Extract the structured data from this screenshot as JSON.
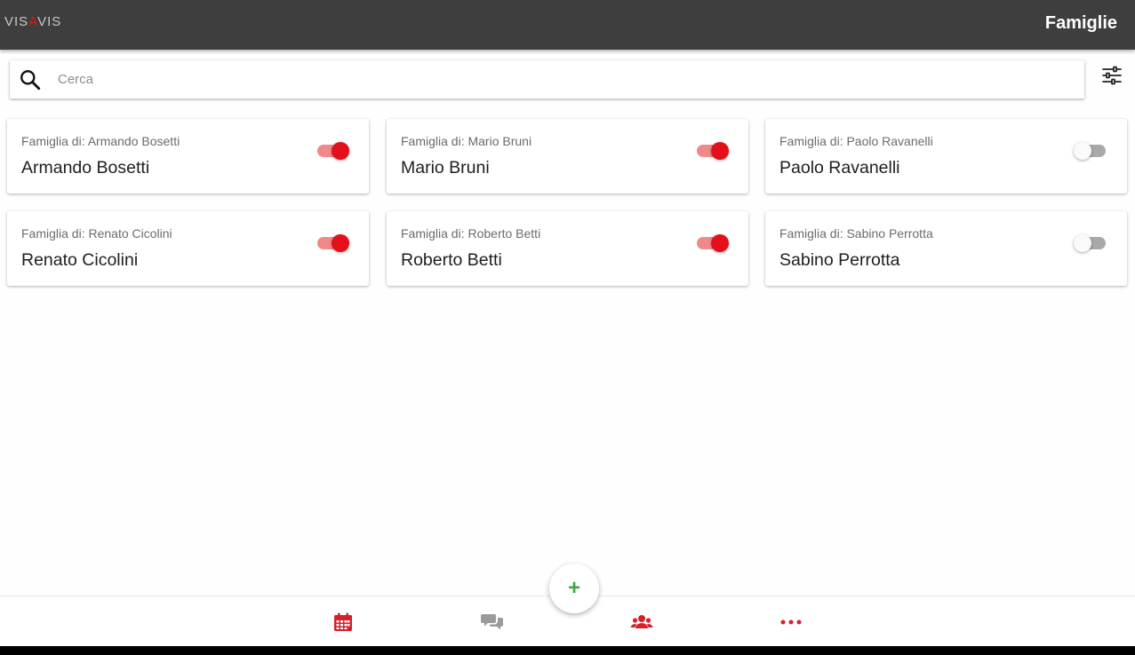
{
  "header": {
    "logo_left": "VIS",
    "logo_accent": "A",
    "logo_right": "VIS",
    "title": "Famiglie"
  },
  "search": {
    "placeholder": "Cerca",
    "value": ""
  },
  "families": [
    {
      "subtitle": "Famiglia di: Armando Bosetti",
      "name": "Armando Bosetti",
      "active": true
    },
    {
      "subtitle": "Famiglia di: Mario Bruni",
      "name": "Mario Bruni",
      "active": true
    },
    {
      "subtitle": "Famiglia di: Paolo Ravanelli",
      "name": "Paolo Ravanelli",
      "active": false
    },
    {
      "subtitle": "Famiglia di: Renato Cicolini",
      "name": "Renato Cicolini",
      "active": true
    },
    {
      "subtitle": "Famiglia di: Roberto Betti",
      "name": "Roberto Betti",
      "active": true
    },
    {
      "subtitle": "Famiglia di: Sabino Perrotta",
      "name": "Sabino Perrotta",
      "active": false
    }
  ],
  "fab": {
    "label": "+"
  },
  "bottom_nav": {
    "items": [
      {
        "icon": "calendar-icon",
        "color": "#d8202a"
      },
      {
        "icon": "chat-icon",
        "color": "#9b9b9b"
      },
      {
        "icon": "users-icon",
        "color": "#d8202a"
      },
      {
        "icon": "more-icon",
        "color": "#d8202a"
      }
    ]
  },
  "colors": {
    "app_bar": "#3d3e3d",
    "accent": "#e3101c",
    "fab_plus": "#3aa93f"
  }
}
